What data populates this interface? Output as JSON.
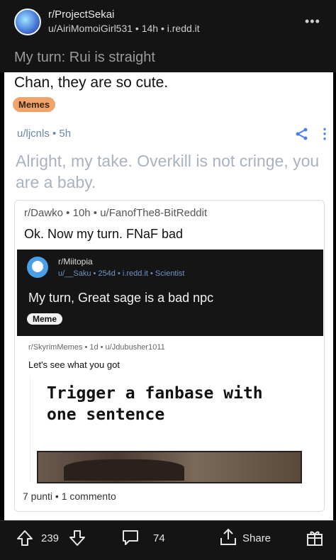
{
  "header": {
    "subreddit": "r/ProjectSekai",
    "meta": "u/AiriMomoiGirl531 • 14h • i.redd.it",
    "title_visible": "My turn: Rui is straight",
    "more_icon": "kebab-icon"
  },
  "post": {
    "title_continuation": "Chan, they are so cute.",
    "flair": "Memes",
    "flair_color": "#f0a36a"
  },
  "comment": {
    "meta": "u/ljcnls • 5h",
    "body": "Alright, my take. Overkill is not cringe, you are a baby.",
    "accent": "#4b7ff0"
  },
  "crosspost": {
    "meta": "r/Dawko • 10h • u/FanofThe8-BitReddit",
    "title": "Ok. Now my turn. FNaF bad"
  },
  "nested": {
    "subreddit": "r/Miitopia",
    "meta": "u/__Saku • 254d • i.redd.it • Scientist",
    "title": "My turn, Great sage is a bad npc",
    "flair": "Meme"
  },
  "skyrim": {
    "meta": "r/SkyrimMemes • 1d • u/Jdubusher1011",
    "text": "Let's see what you got",
    "meme_line1": "Trigger a fanbase with",
    "meme_line2": "one sentence"
  },
  "footer": {
    "stats": "7 punti • 1 commento"
  },
  "bottom_bar": {
    "votes": "239",
    "comments": "74",
    "share": "Share"
  }
}
